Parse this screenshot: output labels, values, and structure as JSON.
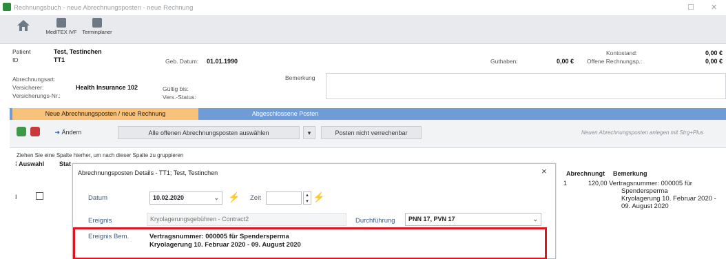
{
  "window": {
    "title": "Rechnungsbuch - neue Abrechnungsposten - neue Rechnung",
    "maximize_glyph": "☐",
    "close_glyph": "✕"
  },
  "toolbar": {
    "buttons": [
      {
        "label": "",
        "icon": "home-icon"
      },
      {
        "label": "MedITEX IVF",
        "icon": "meditex-icon"
      },
      {
        "label": "Terminplaner",
        "icon": "calendar-icon"
      }
    ]
  },
  "patient": {
    "patient_label": "Patient",
    "patient_value": "Test, Testinchen",
    "id_label": "ID",
    "id_value": "TT1",
    "dob_label": "Geb. Datum:",
    "dob_value": "01.01.1990",
    "guthaben_label": "Guthaben:",
    "guthaben_value": "0,00 €",
    "kontostand_label": "Kontostand:",
    "kontostand_value": "0,00 €",
    "offene_label": "Offene Rechnungsp.:",
    "offene_value": "0,00 €"
  },
  "billing": {
    "art_label": "Abrechnungsart:",
    "versicherer_label": "Versicherer:",
    "versicherer_value": "Health Insurance 102",
    "nr_label": "Versicherungs-Nr.:",
    "gueltig_label": "Gültig bis:",
    "status_label": "Vers.-Status:",
    "bemerkung_label": "Bemerkung"
  },
  "tabs": {
    "active": "Neue Abrechnungsposten / neue Rechnung",
    "inactive": "Abgeschlossene Posten"
  },
  "actions": {
    "aendern": "Ändern",
    "select_all": "Alle offenen Abrechnungsposten auswählen",
    "not_billable": "Posten nicht verrechenbar",
    "hint": "Neuen Abrechnungsposten anlegen mit Strg+Plus"
  },
  "grid": {
    "group_hint": "Ziehen Sie eine Spalte hierher, um nach dieser Spalte zu gruppieren",
    "col_auswahl": "Auswahl",
    "col_stat": "Stat",
    "col_abrechnung": "Abrechnungsbetrag",
    "col_abrechnung_short": "Abrechnungt",
    "col_bemerkung": "Bemerkung",
    "row": {
      "marker": "I",
      "count": "1",
      "amount": "120,00",
      "bem_line1": "Vertragsnummer: 000005 für",
      "bem_line2": "Spendersperma",
      "bem_line3": "Kryolagerung 10. Februar 2020 -",
      "bem_line4": "09. August 2020"
    }
  },
  "dialog": {
    "title": "Abrechnungsposten Details - TT1; Test, Testinchen",
    "datum_label": "Datum",
    "datum_value": "10.02.2020",
    "zeit_label": "Zeit",
    "zeit_value": "",
    "ereignis_label": "Ereignis",
    "ereignis_value": "Kryolagerungsgebühren - Contract2",
    "durchfuehrung_label": "Durchführung",
    "durchfuehrung_value": "PNN 17, PVN 17",
    "bem_label": "Ereignis Bem.",
    "bem_line1": "Vertragsnummer: 000005 für Spendersperma",
    "bem_line2": "Kryolagerung 10. Februar 2020 - 09. August 2020"
  },
  "colors": {
    "highlight": "#e0141c",
    "tab_active": "#f8c27a",
    "tab_bar": "#6f9bd6"
  }
}
